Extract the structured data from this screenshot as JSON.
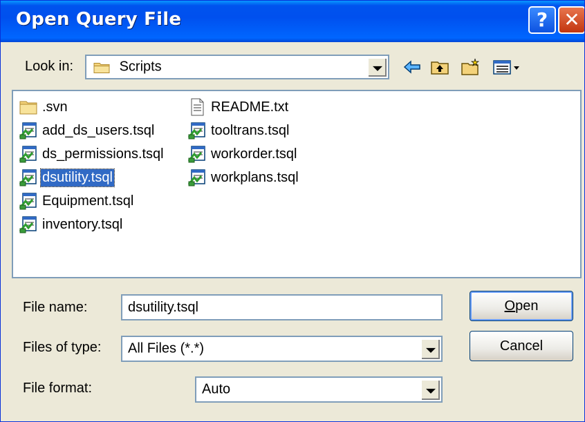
{
  "window": {
    "title": "Open Query File",
    "help_label": "?",
    "close_label": "✕"
  },
  "lookin": {
    "label": "Look in:",
    "value": "Scripts"
  },
  "toolbar": {
    "icons": [
      "back-arrow-icon",
      "up-folder-icon",
      "new-folder-icon",
      "view-menu-icon"
    ]
  },
  "files": {
    "column1": [
      {
        "name": ".svn",
        "icon": "folder-icon",
        "selected": false
      },
      {
        "name": "add_ds_users.tsql",
        "icon": "sql-file-icon",
        "selected": false
      },
      {
        "name": "ds_permissions.tsql",
        "icon": "sql-file-icon",
        "selected": false
      },
      {
        "name": "dsutility.tsql",
        "icon": "sql-file-icon",
        "selected": true
      },
      {
        "name": "Equipment.tsql",
        "icon": "sql-file-icon",
        "selected": false
      },
      {
        "name": "inventory.tsql",
        "icon": "sql-file-icon",
        "selected": false
      }
    ],
    "column2": [
      {
        "name": "README.txt",
        "icon": "text-file-icon",
        "selected": false
      },
      {
        "name": "tooltrans.tsql",
        "icon": "sql-file-icon",
        "selected": false
      },
      {
        "name": "workorder.tsql",
        "icon": "sql-file-icon",
        "selected": false
      },
      {
        "name": "workplans.tsql",
        "icon": "sql-file-icon",
        "selected": false
      }
    ]
  },
  "filename": {
    "label": "File name:",
    "value": "dsutility.tsql"
  },
  "filetype": {
    "label": "Files of type:",
    "value": "All Files (*.*)"
  },
  "fileformat": {
    "label": "File format:",
    "value": "Auto"
  },
  "buttons": {
    "open": "Open",
    "cancel": "Cancel"
  },
  "colors": {
    "title_bar": "#0053ee",
    "selection": "#316ac5",
    "face": "#ece9d8"
  }
}
